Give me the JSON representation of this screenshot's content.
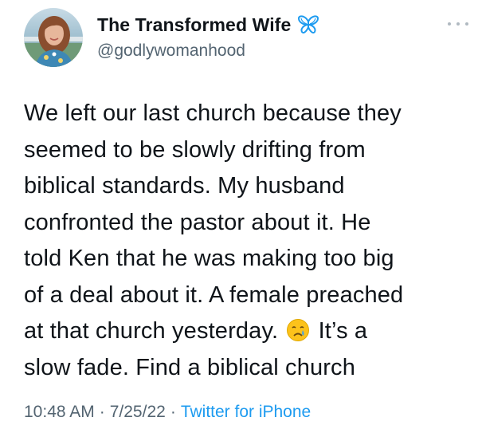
{
  "author": {
    "display_name": "The Transformed Wife",
    "handle": "@godlywomanhood",
    "avatar_icon": "profile-photo-woman",
    "badge_icon": "butterfly-icon",
    "badge_color": "#1d9bf0"
  },
  "menu": {
    "icon": "more-options-icon"
  },
  "tweet": {
    "lines": [
      "We left our last church because they",
      "seemed to be slowly drifting from",
      "biblical standards. My husband",
      "confronted the pastor about it. He",
      "told Ken that he was making too big",
      "of a deal about it. A female preached",
      "at that church yesterday.",
      "It’s a",
      "slow fade. Find a biblical church"
    ],
    "emoji_icon": "crying-face-emoji"
  },
  "meta": {
    "time": "10:48 AM",
    "date": "7/25/22",
    "separator": "·",
    "source": "Twitter for iPhone"
  },
  "colors": {
    "text": "#0f1419",
    "secondary": "#536471",
    "link": "#1d9bf0"
  }
}
